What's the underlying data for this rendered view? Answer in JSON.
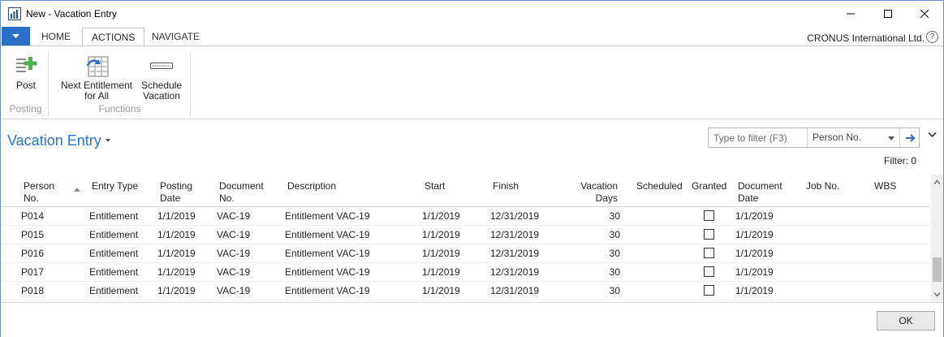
{
  "window": {
    "title": "New - Vacation Entry",
    "company": "CRONUS International Ltd.",
    "help_label": "?"
  },
  "ribbon": {
    "tabs": [
      {
        "label": "HOME",
        "active": false
      },
      {
        "label": "ACTIONS",
        "active": true
      },
      {
        "label": "NAVIGATE",
        "active": false
      }
    ],
    "groups": [
      {
        "label": "Posting",
        "buttons": [
          {
            "label": "Post",
            "icon": "post-icon"
          }
        ]
      },
      {
        "label": "Functions",
        "buttons": [
          {
            "label": "Next Entitlement for All",
            "icon": "next-entitlement-icon"
          },
          {
            "label": "Schedule Vacation",
            "icon": "schedule-vacation-icon"
          }
        ]
      }
    ]
  },
  "page": {
    "title": "Vacation Entry",
    "filter_placeholder": "Type to filter (F3)",
    "filter_field": "Person No.",
    "filter_count": "Filter: 0"
  },
  "grid": {
    "columns": [
      "Person No.",
      "Entry Type",
      "Posting Date",
      "Document No.",
      "Description",
      "Start",
      "Finish",
      "Vacation Days",
      "Scheduled",
      "Granted",
      "Document Date",
      "Job No.",
      "WBS"
    ],
    "rows": [
      {
        "person": "P014",
        "type": "Entitlement",
        "posting": "1/1/2019",
        "doc": "VAC-19",
        "desc": "Entitlement VAC-19",
        "start": "1/1/2019",
        "finish": "12/31/2019",
        "days": "30",
        "granted": false,
        "docdate": "1/1/2019"
      },
      {
        "person": "P015",
        "type": "Entitlement",
        "posting": "1/1/2019",
        "doc": "VAC-19",
        "desc": "Entitlement VAC-19",
        "start": "1/1/2019",
        "finish": "12/31/2019",
        "days": "30",
        "granted": false,
        "docdate": "1/1/2019"
      },
      {
        "person": "P016",
        "type": "Entitlement",
        "posting": "1/1/2019",
        "doc": "VAC-19",
        "desc": "Entitlement VAC-19",
        "start": "1/1/2019",
        "finish": "12/31/2019",
        "days": "30",
        "granted": false,
        "docdate": "1/1/2019"
      },
      {
        "person": "P017",
        "type": "Entitlement",
        "posting": "1/1/2019",
        "doc": "VAC-19",
        "desc": "Entitlement VAC-19",
        "start": "1/1/2019",
        "finish": "12/31/2019",
        "days": "30",
        "granted": false,
        "docdate": "1/1/2019"
      },
      {
        "person": "P018",
        "type": "Entitlement",
        "posting": "1/1/2019",
        "doc": "VAC-19",
        "desc": "Entitlement VAC-19",
        "start": "1/1/2019",
        "finish": "12/31/2019",
        "days": "30",
        "granted": false,
        "docdate": "1/1/2019"
      }
    ]
  },
  "footer": {
    "ok_label": "OK"
  },
  "colors": {
    "accent": "#2b6fc6",
    "title_blue": "#2b73c7"
  }
}
